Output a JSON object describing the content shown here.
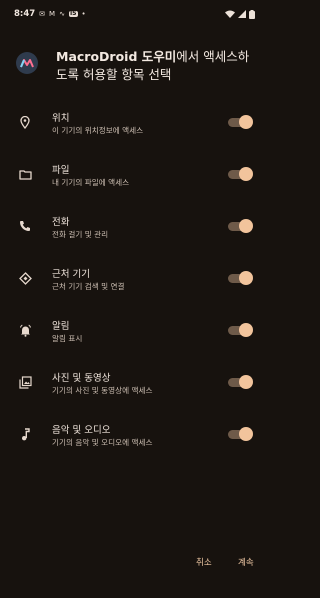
{
  "status_bar": {
    "time": "8:47",
    "notification_icons": [
      "messages-icon",
      "gmail-icon",
      "messages-icon",
      "activity-icon",
      "box-app-icon",
      "dot-icon"
    ],
    "box_label": "IS",
    "system_icons": [
      "wifi-icon",
      "signal-icon",
      "battery-icon"
    ]
  },
  "dialog": {
    "app_name": "MacroDroid 도우미",
    "title_rest": "에서 액세스하도록 허용할 항목 선택",
    "permissions": [
      {
        "title": "위치",
        "desc": "이 기기의 위치정보에 액세스",
        "icon": "location-pin-icon",
        "enabled": true
      },
      {
        "title": "파일",
        "desc": "내 기기의 파일에 액세스",
        "icon": "folder-icon",
        "enabled": true
      },
      {
        "title": "전화",
        "desc": "전화 걸기 및 관리",
        "icon": "phone-icon",
        "enabled": true
      },
      {
        "title": "근처 기기",
        "desc": "근처 기기 검색 및 연결",
        "icon": "nearby-devices-icon",
        "enabled": true
      },
      {
        "title": "알림",
        "desc": "알림 표시",
        "icon": "bell-icon",
        "enabled": true
      },
      {
        "title": "사진 및 동영상",
        "desc": "기기의 사진 및 동영상에 액세스",
        "icon": "photo-library-icon",
        "enabled": true
      },
      {
        "title": "음악 및 오디오",
        "desc": "기기의 음악 및 오디오에 액세스",
        "icon": "music-note-icon",
        "enabled": true
      }
    ],
    "cancel_label": "취소",
    "continue_label": "계속"
  },
  "colors": {
    "background": "#17120e",
    "accent": "#f2c49c",
    "toggle_track": "#6e5a49"
  }
}
